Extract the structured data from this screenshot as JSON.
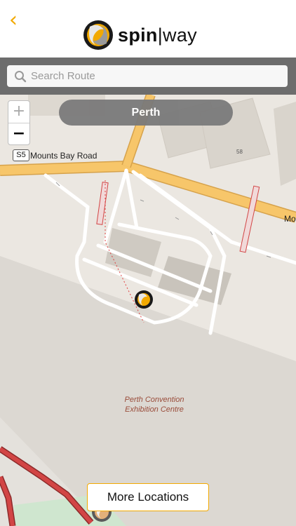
{
  "header": {
    "back_icon": "chevron-left-icon",
    "logo_bold": "spin",
    "logo_separator": "|",
    "logo_light": "way"
  },
  "search": {
    "placeholder": "Search Route",
    "value": ""
  },
  "map": {
    "zoom_in_label": "+",
    "zoom_out_label": "−",
    "city": "Perth",
    "road_shield": "S5",
    "road_name": "Mounts Bay Road",
    "road_name_right": "Mo",
    "building_number": "58",
    "poi_label_line1": "Perth Convention",
    "poi_label_line2": "Exhibition Centre"
  },
  "footer": {
    "more_locations_label": "More Locations"
  },
  "colors": {
    "accent": "#f2a900",
    "map_land": "#ebe7e1",
    "major_road": "#f7c66a",
    "route_red": "#d23f3f"
  }
}
